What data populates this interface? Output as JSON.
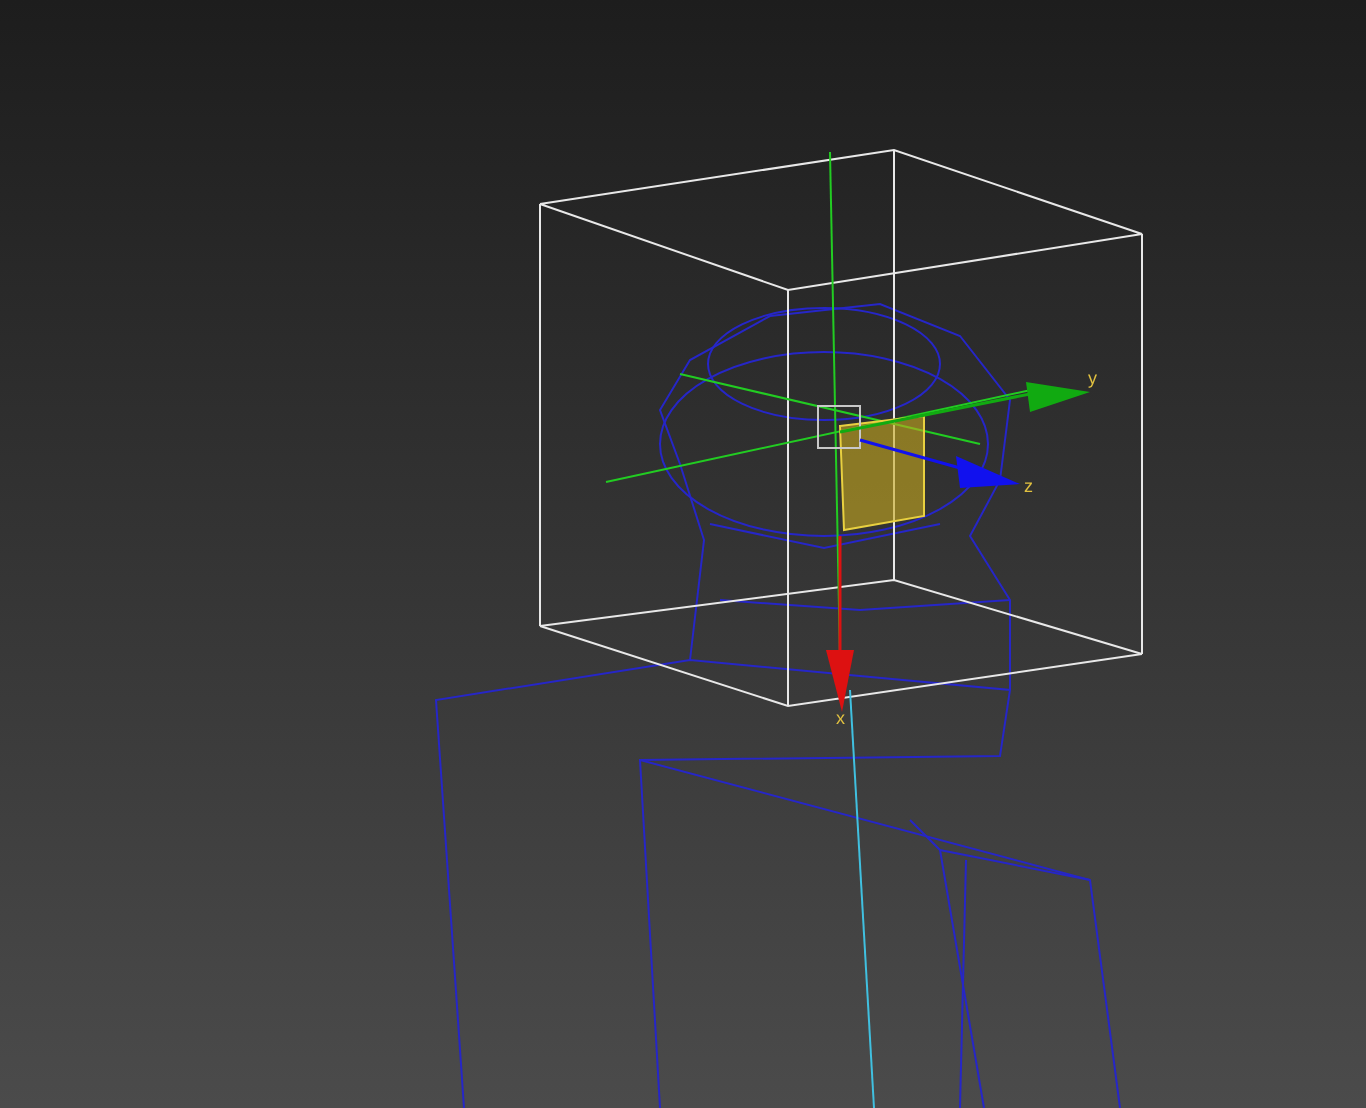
{
  "viewport": {
    "gizmo_axes": [
      {
        "label": "y",
        "color": "#11aa11"
      },
      {
        "label": "z",
        "color": "#1111ee"
      },
      {
        "label": "x",
        "color": "#dd1111"
      }
    ]
  }
}
